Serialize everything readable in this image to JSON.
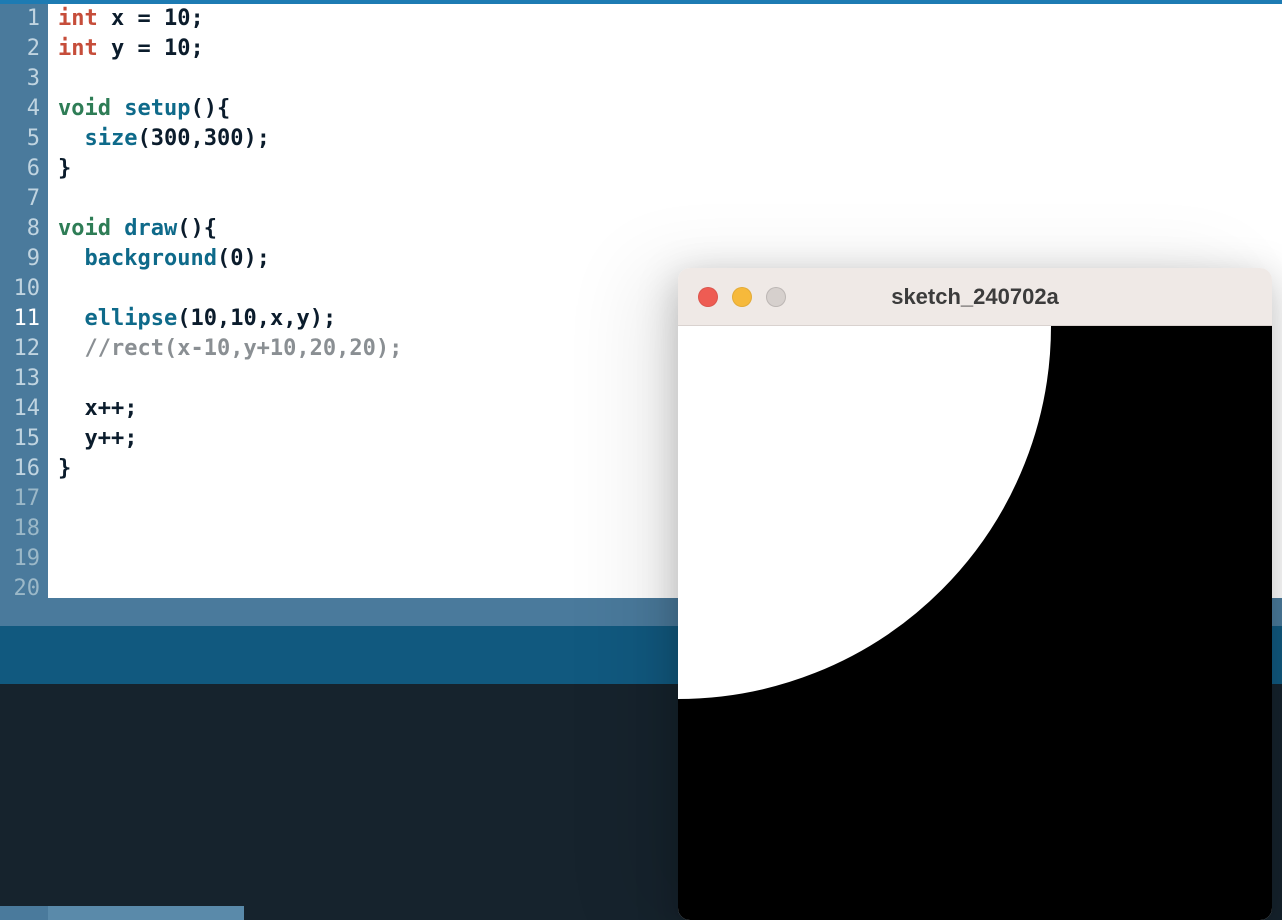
{
  "editor": {
    "highlighted_line_index": 10,
    "line_count": 20,
    "lines": [
      {
        "tokens": [
          {
            "cls": "tk-typeint",
            "t": "int"
          },
          {
            "cls": "",
            "t": " "
          },
          {
            "cls": "tk-ident",
            "t": "x"
          },
          {
            "cls": "",
            "t": " "
          },
          {
            "cls": "tk-op",
            "t": "="
          },
          {
            "cls": "",
            "t": " "
          },
          {
            "cls": "tk-num",
            "t": "10"
          },
          {
            "cls": "tk-semi",
            "t": ";"
          }
        ]
      },
      {
        "tokens": [
          {
            "cls": "tk-typeint",
            "t": "int"
          },
          {
            "cls": "",
            "t": " "
          },
          {
            "cls": "tk-ident",
            "t": "y"
          },
          {
            "cls": "",
            "t": " "
          },
          {
            "cls": "tk-op",
            "t": "="
          },
          {
            "cls": "",
            "t": " "
          },
          {
            "cls": "tk-num",
            "t": "10"
          },
          {
            "cls": "tk-semi",
            "t": ";"
          }
        ]
      },
      {
        "tokens": []
      },
      {
        "tokens": [
          {
            "cls": "tk-kw",
            "t": "void"
          },
          {
            "cls": "",
            "t": " "
          },
          {
            "cls": "tk-func",
            "t": "setup"
          },
          {
            "cls": "tk-paren",
            "t": "()"
          },
          {
            "cls": "tk-paren",
            "t": "{"
          }
        ]
      },
      {
        "tokens": [
          {
            "cls": "",
            "t": "  "
          },
          {
            "cls": "tk-func",
            "t": "size"
          },
          {
            "cls": "tk-paren",
            "t": "("
          },
          {
            "cls": "tk-num",
            "t": "300"
          },
          {
            "cls": "tk-op",
            "t": ","
          },
          {
            "cls": "tk-num",
            "t": "300"
          },
          {
            "cls": "tk-paren",
            "t": ")"
          },
          {
            "cls": "tk-semi",
            "t": ";"
          }
        ]
      },
      {
        "tokens": [
          {
            "cls": "tk-paren",
            "t": "}"
          }
        ]
      },
      {
        "tokens": []
      },
      {
        "tokens": [
          {
            "cls": "tk-kw",
            "t": "void"
          },
          {
            "cls": "",
            "t": " "
          },
          {
            "cls": "tk-func",
            "t": "draw"
          },
          {
            "cls": "tk-paren",
            "t": "()"
          },
          {
            "cls": "tk-paren",
            "t": "{"
          }
        ]
      },
      {
        "tokens": [
          {
            "cls": "",
            "t": "  "
          },
          {
            "cls": "tk-func",
            "t": "background"
          },
          {
            "cls": "tk-paren",
            "t": "("
          },
          {
            "cls": "tk-num",
            "t": "0"
          },
          {
            "cls": "tk-paren",
            "t": ")"
          },
          {
            "cls": "tk-semi",
            "t": ";"
          }
        ]
      },
      {
        "tokens": []
      },
      {
        "tokens": [
          {
            "cls": "",
            "t": "  "
          },
          {
            "cls": "tk-func",
            "t": "ellipse"
          },
          {
            "cls": "tk-paren",
            "t": "("
          },
          {
            "cls": "tk-num",
            "t": "10"
          },
          {
            "cls": "tk-op",
            "t": ","
          },
          {
            "cls": "tk-num",
            "t": "10"
          },
          {
            "cls": "tk-op",
            "t": ","
          },
          {
            "cls": "tk-ident",
            "t": "x"
          },
          {
            "cls": "tk-op",
            "t": ","
          },
          {
            "cls": "tk-ident",
            "t": "y"
          },
          {
            "cls": "tk-paren",
            "t": ")"
          },
          {
            "cls": "tk-semi",
            "t": ";"
          }
        ]
      },
      {
        "tokens": [
          {
            "cls": "",
            "t": "  "
          },
          {
            "cls": "tk-comment",
            "t": "//rect(x-10,y+10,20,20);"
          }
        ]
      },
      {
        "tokens": []
      },
      {
        "tokens": [
          {
            "cls": "",
            "t": "  "
          },
          {
            "cls": "tk-ident",
            "t": "x"
          },
          {
            "cls": "tk-op",
            "t": "++"
          },
          {
            "cls": "tk-semi",
            "t": ";"
          }
        ]
      },
      {
        "tokens": [
          {
            "cls": "",
            "t": "  "
          },
          {
            "cls": "tk-ident",
            "t": "y"
          },
          {
            "cls": "tk-op",
            "t": "++"
          },
          {
            "cls": "tk-semi",
            "t": ";"
          }
        ]
      },
      {
        "tokens": [
          {
            "cls": "tk-paren",
            "t": "}"
          }
        ]
      },
      {
        "tokens": []
      },
      {
        "tokens": []
      },
      {
        "tokens": []
      },
      {
        "tokens": []
      }
    ]
  },
  "sketch_window": {
    "title": "sketch_240702a"
  }
}
